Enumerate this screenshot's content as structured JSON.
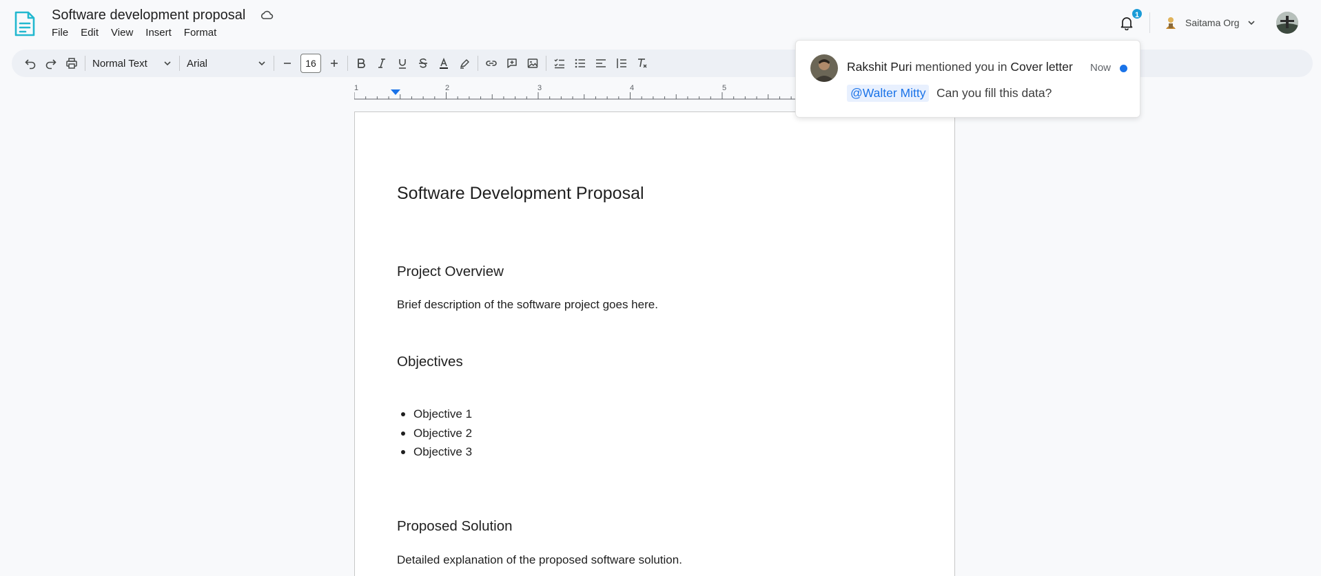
{
  "header": {
    "title": "Software development proposal",
    "menu": [
      "File",
      "Edit",
      "View",
      "Insert",
      "Format"
    ],
    "notifications_count": "1",
    "org_name": "Saitama Org"
  },
  "toolbar": {
    "style_select": "Normal Text",
    "font_select": "Arial",
    "font_size": "16"
  },
  "ruler": {
    "labels": [
      "1",
      "2",
      "3",
      "4",
      "5"
    ]
  },
  "document": {
    "title": "Software Development Proposal",
    "section1_heading": "Project Overview",
    "section1_body": "Brief description of the software project goes here.",
    "section2_heading": "Objectives",
    "objectives": [
      "Objective 1",
      "Objective 2",
      "Objective 3"
    ],
    "section3_heading": "Proposed Solution",
    "section3_body": "Detailed explanation of the proposed software solution."
  },
  "notification": {
    "author": "Rakshit Puri",
    "action": "mentioned you in",
    "target": "Cover letter",
    "time": "Now",
    "mention": "@Walter Mitty",
    "message": "Can you fill this data?"
  },
  "colors": {
    "accent": "#1a73e8",
    "badge": "#1a9bd7",
    "logo": "#22b8cf",
    "toolbar_bg": "#edf0f5"
  },
  "icons": [
    "doc-logo-icon",
    "cloud-icon",
    "bell-icon",
    "undo-icon",
    "redo-icon",
    "print-icon",
    "bold-icon",
    "italic-icon",
    "underline-icon",
    "strikethrough-icon",
    "text-color-icon",
    "highlight-icon",
    "link-icon",
    "comment-icon",
    "image-icon",
    "checklist-icon",
    "bullet-list-icon",
    "align-left-icon",
    "numbered-list-icon",
    "clear-format-icon"
  ]
}
